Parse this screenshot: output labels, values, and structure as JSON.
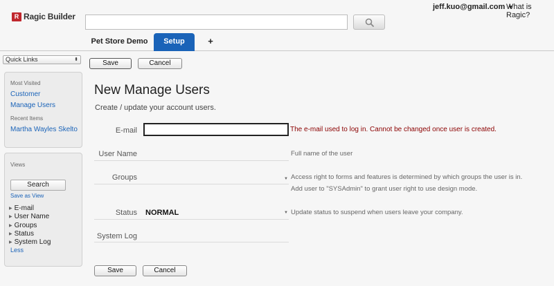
{
  "header": {
    "logo_mark": "R",
    "logo_text": "Ragic Builder",
    "search": {
      "value": "",
      "placeholder": ""
    },
    "search_button_icon": "search-icon",
    "user_email": "jeff.kuo@gmail.com",
    "user_caret": "▼",
    "help_link": "What is Ragic?",
    "tabs": [
      {
        "label": "Pet Store Demo",
        "active": false
      },
      {
        "label": "Setup",
        "active": true
      },
      {
        "label": "+",
        "active": false
      }
    ],
    "accent_color": "#1a63b8",
    "logo_color": "#c0272d"
  },
  "sidebar": {
    "quick_links": "Quick Links",
    "most_visited_label": "Most Visited",
    "most_visited": [
      "Customer",
      "Manage Users"
    ],
    "recent_label": "Recent Items",
    "recent": [
      "Martha Wayles Skelto"
    ],
    "views_label": "Views",
    "search_button": "Search",
    "save_view": "Save as View",
    "fields": [
      "E-mail",
      "User Name",
      "Groups",
      "Status",
      "System Log"
    ],
    "less": "Less"
  },
  "main": {
    "save_label": "Save",
    "cancel_label": "Cancel",
    "title": "New Manage Users",
    "subtitle": "Create / update your account users.",
    "fields": {
      "email": {
        "label": "E-mail",
        "value": "",
        "help": "The e-mail used to log in. Cannot be changed once user is created."
      },
      "username": {
        "label": "User Name",
        "help": "Full name of the user"
      },
      "groups": {
        "label": "Groups",
        "help_line1": "Access right to forms and features is determined by which groups the user is in.",
        "help_line2": "Add user to \"SYSAdmin\" to grant user right to use design mode."
      },
      "status": {
        "label": "Status",
        "value": "NORMAL",
        "help": "Update status to suspend when users leave your company."
      },
      "system_log": {
        "label": "System Log"
      }
    },
    "error_color": "#8b0000"
  }
}
